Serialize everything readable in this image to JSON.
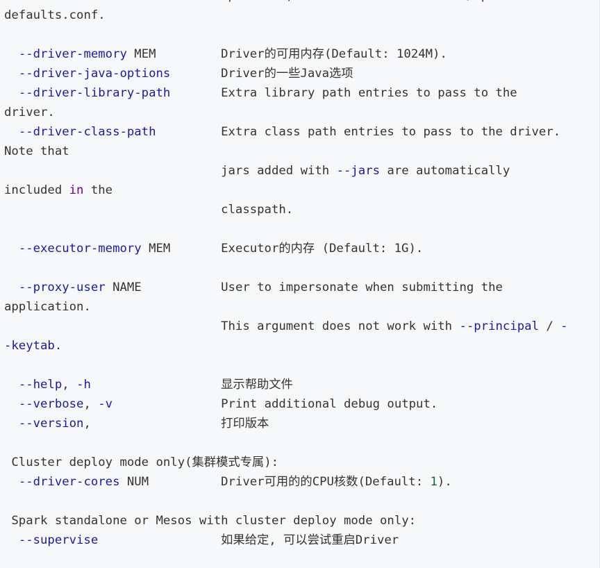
{
  "lines": [
    {
      "p": [
        {
          "t": "                              specified, this will look "
        },
        {
          "t": "for",
          "c": "kw"
        },
        {
          "t": " conf/spark-"
        }
      ]
    },
    {
      "p": [
        {
          "t": "defaults.conf."
        }
      ]
    },
    {
      "p": []
    },
    {
      "p": [
        {
          "t": "  "
        },
        {
          "t": "--driver-memory",
          "c": "opt"
        },
        {
          "t": " MEM         Driver的可用内存(Default: 1024M)."
        }
      ]
    },
    {
      "p": [
        {
          "t": "  "
        },
        {
          "t": "--driver-java-options",
          "c": "opt"
        },
        {
          "t": "       Driver的一些Java选项"
        }
      ]
    },
    {
      "p": [
        {
          "t": "  "
        },
        {
          "t": "--driver-library-path",
          "c": "opt"
        },
        {
          "t": "       Extra library path entries to pass to the"
        }
      ]
    },
    {
      "p": [
        {
          "t": "driver."
        }
      ]
    },
    {
      "p": [
        {
          "t": "  "
        },
        {
          "t": "--driver-class-path",
          "c": "opt"
        },
        {
          "t": "         Extra class path entries to pass to the driver."
        }
      ]
    },
    {
      "p": [
        {
          "t": "Note that"
        }
      ]
    },
    {
      "p": [
        {
          "t": "                              jars added with "
        },
        {
          "t": "--jars",
          "c": "opt"
        },
        {
          "t": " are automatically"
        }
      ]
    },
    {
      "p": [
        {
          "t": "included "
        },
        {
          "t": "in",
          "c": "kw"
        },
        {
          "t": " the"
        }
      ]
    },
    {
      "p": [
        {
          "t": "                              classpath."
        }
      ]
    },
    {
      "p": []
    },
    {
      "p": [
        {
          "t": "  "
        },
        {
          "t": "--executor-memory",
          "c": "opt"
        },
        {
          "t": " MEM       Executor的内存 (Default: 1G)."
        }
      ]
    },
    {
      "p": []
    },
    {
      "p": [
        {
          "t": "  "
        },
        {
          "t": "--proxy-user",
          "c": "opt"
        },
        {
          "t": " NAME           User to impersonate when submitting the"
        }
      ]
    },
    {
      "p": [
        {
          "t": "application."
        }
      ]
    },
    {
      "p": [
        {
          "t": "                              This argument does not work with "
        },
        {
          "t": "--principal",
          "c": "opt"
        },
        {
          "t": " / "
        },
        {
          "t": "-",
          "c": "opt"
        }
      ]
    },
    {
      "p": [
        {
          "t": "-keytab",
          "c": "opt"
        },
        {
          "t": "."
        }
      ]
    },
    {
      "p": []
    },
    {
      "p": [
        {
          "t": "  "
        },
        {
          "t": "--help",
          "c": "opt"
        },
        {
          "t": ", "
        },
        {
          "t": "-h",
          "c": "opt"
        },
        {
          "t": "                  显示帮助文件"
        }
      ]
    },
    {
      "p": [
        {
          "t": "  "
        },
        {
          "t": "--verbose",
          "c": "opt"
        },
        {
          "t": ", "
        },
        {
          "t": "-v",
          "c": "opt"
        },
        {
          "t": "               Print additional debug output."
        }
      ]
    },
    {
      "p": [
        {
          "t": "  "
        },
        {
          "t": "--version",
          "c": "opt"
        },
        {
          "t": ",                  打印版本"
        }
      ]
    },
    {
      "p": []
    },
    {
      "p": [
        {
          "t": " Cluster deploy mode only(集群模式专属):"
        }
      ]
    },
    {
      "p": [
        {
          "t": "  "
        },
        {
          "t": "--driver-cores",
          "c": "opt"
        },
        {
          "t": " NUM          Driver可用的的CPU核数(Default: "
        },
        {
          "t": "1",
          "c": "num"
        },
        {
          "t": ")."
        }
      ]
    },
    {
      "p": []
    },
    {
      "p": [
        {
          "t": " Spark standalone or Mesos with cluster deploy mode only:"
        }
      ]
    },
    {
      "p": [
        {
          "t": "  "
        },
        {
          "t": "--supervise",
          "c": "opt"
        },
        {
          "t": "                 如果给定, 可以尝试重启Driver"
        }
      ]
    },
    {
      "p": []
    }
  ]
}
